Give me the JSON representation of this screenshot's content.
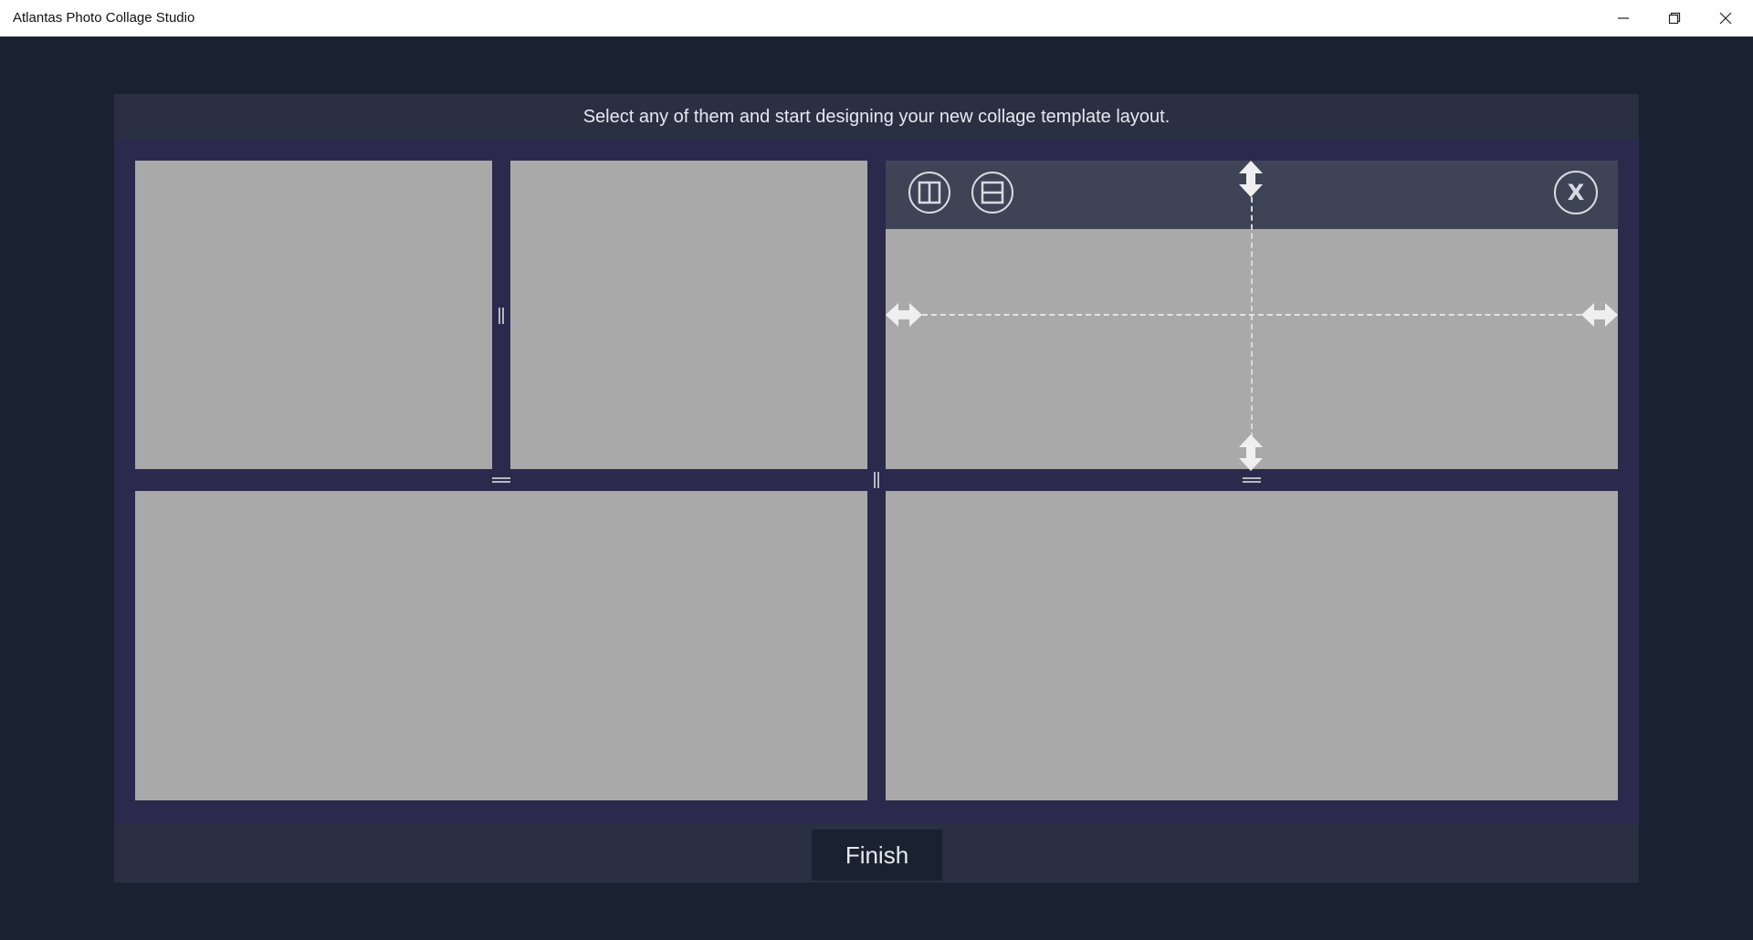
{
  "window": {
    "title": "Atlantas Photo Collage Studio",
    "controls": [
      "minimize",
      "restore",
      "close"
    ]
  },
  "instruction": "Select any of them and start designing your new collage template layout.",
  "selected_cell": {
    "toolbar": {
      "split_vertical_icon": "split-vertical-icon",
      "split_horizontal_icon": "split-horizontal-icon",
      "close_label": "X"
    }
  },
  "footer": {
    "finish_label": "Finish"
  },
  "colors": {
    "background": "#1a2231",
    "card": "#2a2f42",
    "canvas": "#2b2a4d",
    "cell": "#a9a9a9",
    "toolbar": "#3e4455"
  }
}
